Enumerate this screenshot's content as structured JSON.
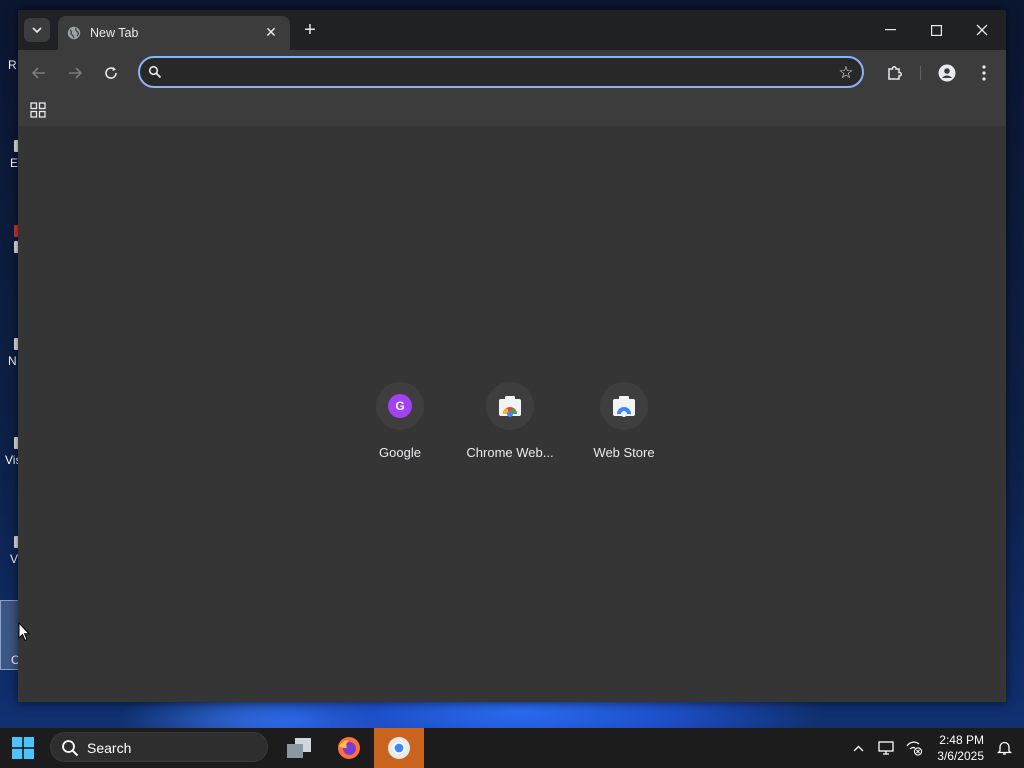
{
  "desktop": {
    "icon_labels": [
      "R",
      "E",
      "N",
      "Vis",
      "V",
      "C"
    ]
  },
  "browser": {
    "tab": {
      "title": "New Tab"
    },
    "omnibox": {
      "value": "",
      "placeholder": ""
    },
    "shortcuts": [
      {
        "label": "Google",
        "letter": "G",
        "icon": "google-letter-icon"
      },
      {
        "label": "Chrome Web...",
        "icon": "chrome-web-store-icon"
      },
      {
        "label": "Web Store",
        "icon": "web-store-icon"
      }
    ],
    "icons": {
      "tab_search": "chevron-down-icon",
      "favicon": "globe-icon",
      "tab_close": "close-icon",
      "new_tab": "plus-icon",
      "back": "arrow-left-icon",
      "forward": "arrow-right-icon",
      "reload": "reload-icon",
      "bookmark": "star-icon",
      "extensions": "puzzle-icon",
      "profile": "person-icon",
      "menu": "kebab-menu-icon",
      "apps": "grid-icon"
    }
  },
  "taskbar": {
    "search_label": "Search",
    "time": "2:48 PM",
    "date": "3/6/2025",
    "apps": [
      "task-view",
      "firefox",
      "chrome"
    ]
  },
  "colors": {
    "accent": "#8ab4f8",
    "tab_strip": "#202124",
    "toolbar": "#3c3c3c",
    "content": "#353535",
    "active_task": "#c8641e"
  }
}
